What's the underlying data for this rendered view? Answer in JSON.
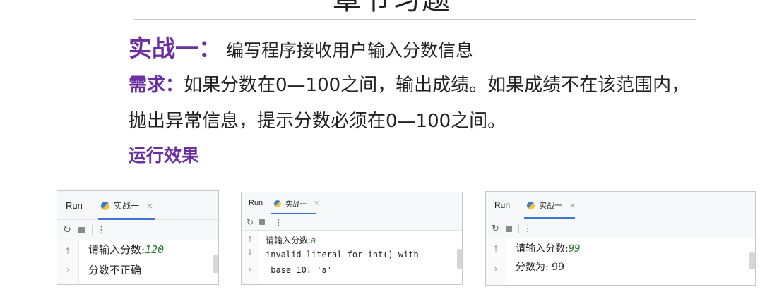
{
  "slide": {
    "title": "章节习题",
    "exercise_label": "实战一：",
    "exercise_text": "编写程序接收用户输入分数信息",
    "req_label": "需求：",
    "req_text_1": "如果分数在0—100之间，输出成绩。如果成绩不在该范围内，",
    "req_text_2": "抛出异常信息，提示分数必须在0—100之间。",
    "result_label": "运行效果"
  },
  "panels": [
    {
      "run_label": "Run",
      "tab_label": "实战一",
      "tab_close": "×",
      "icons": [
        "rerun-icon",
        "stop-icon",
        "more-icon",
        "up-arrow-icon",
        "right-arrow-icon"
      ],
      "lines": [
        {
          "prompt": "请输入分数:",
          "value": "120"
        },
        {
          "text": "分数不正确"
        }
      ]
    },
    {
      "run_label": "Run",
      "tab_label": "实战一",
      "tab_close": "×",
      "icons": [
        "rerun-icon",
        "stop-icon",
        "more-icon",
        "up-arrow-icon",
        "down-arrow-icon",
        "right-arrow-icon"
      ],
      "lines": [
        {
          "prompt": "请输入分数:",
          "value": "a"
        },
        {
          "text": "invalid literal for int() with"
        },
        {
          "text": " base 10: 'a'"
        }
      ]
    },
    {
      "run_label": "Run",
      "tab_label": "实战一",
      "tab_close": "×",
      "icons": [
        "rerun-icon",
        "stop-icon",
        "more-icon",
        "up-arrow-icon",
        "right-arrow-icon"
      ],
      "lines": [
        {
          "prompt": "请输入分数:",
          "value": "99"
        },
        {
          "text": "分数为: 99"
        }
      ]
    }
  ],
  "glyphs": {
    "rerun": "↻",
    "more": "⋮",
    "up": "↑",
    "down": "↓",
    "right": "›"
  },
  "colors": {
    "accent": "#6a2fa0",
    "input_value": "#2e7d32",
    "tab_underline": "#3f74d6"
  }
}
